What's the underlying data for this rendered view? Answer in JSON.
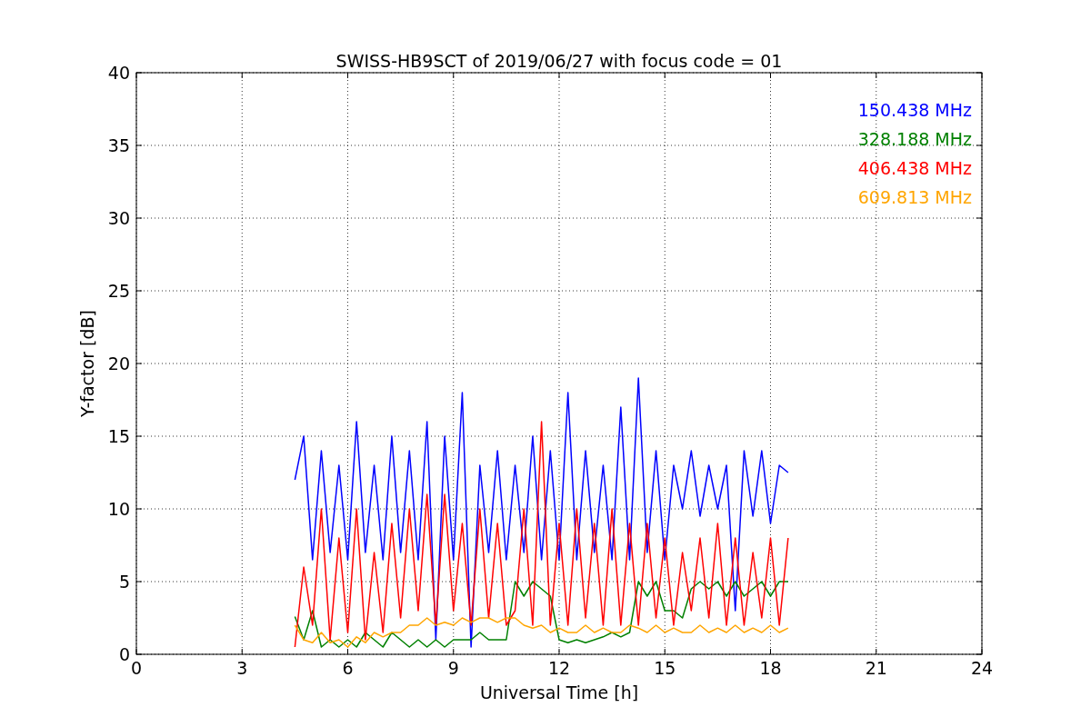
{
  "chart_data": {
    "type": "line",
    "grid": true,
    "title": "SWISS-HB9SCT of 2019/06/27 with focus code = 01",
    "xlabel": "Universal Time [h]",
    "ylabel": "Y-factor [dB]",
    "xlim": [
      0,
      24
    ],
    "ylim": [
      0,
      40
    ],
    "xticks": [
      0,
      3,
      6,
      9,
      12,
      15,
      18,
      21,
      24
    ],
    "yticks": [
      0,
      5,
      10,
      15,
      20,
      25,
      30,
      35,
      40
    ],
    "x": [
      4.5,
      4.75,
      5,
      5.25,
      5.5,
      5.75,
      6,
      6.25,
      6.5,
      6.75,
      7,
      7.25,
      7.5,
      7.75,
      8,
      8.25,
      8.5,
      8.75,
      9,
      9.25,
      9.5,
      9.75,
      10,
      10.25,
      10.5,
      10.75,
      11,
      11.25,
      11.5,
      11.75,
      12,
      12.25,
      12.5,
      12.75,
      13,
      13.25,
      13.5,
      13.75,
      14,
      14.25,
      14.5,
      14.75,
      15,
      15.25,
      15.5,
      15.75,
      16,
      16.25,
      16.5,
      16.75,
      17,
      17.25,
      17.5,
      17.75,
      18,
      18.25,
      18.5
    ],
    "series": [
      {
        "name": "150.438 MHz",
        "color": "#0000ff",
        "values": [
          12,
          15,
          6.5,
          14,
          7,
          13,
          6.5,
          16,
          7,
          13,
          6.5,
          15,
          7,
          14,
          6.5,
          16,
          1,
          15,
          6.5,
          18,
          0.5,
          13,
          7,
          14,
          6.5,
          13,
          7,
          15,
          6.5,
          14,
          6.5,
          18,
          6.5,
          14,
          7,
          13,
          6.5,
          17,
          6.5,
          19,
          7,
          14,
          6.5,
          13,
          10,
          14,
          9.5,
          13,
          10,
          13,
          3,
          14,
          9.5,
          14,
          9,
          13,
          12.5
        ]
      },
      {
        "name": "328.188 MHz",
        "color": "#008000",
        "values": [
          2.6,
          1,
          3,
          0.5,
          1,
          0.5,
          1,
          0.5,
          1.5,
          1,
          0.5,
          1.5,
          1,
          0.5,
          1,
          0.5,
          1,
          0.5,
          1,
          1,
          1,
          1.5,
          1,
          1,
          1,
          5,
          4,
          5,
          4.5,
          4,
          1,
          0.8,
          1,
          0.8,
          1,
          1.2,
          1.5,
          1.2,
          1.5,
          5,
          4,
          5,
          3,
          3,
          2.5,
          4.5,
          5,
          4.5,
          5,
          4,
          5,
          4,
          4.5,
          5,
          4,
          5,
          5
        ]
      },
      {
        "name": "406.438 MHz",
        "color": "#ff0000",
        "values": [
          0.5,
          6,
          2,
          10,
          1,
          8,
          1.5,
          10,
          1,
          7,
          1.5,
          9,
          2.5,
          10,
          3,
          11,
          2,
          11,
          3,
          9,
          2,
          10,
          2.5,
          9,
          2,
          3,
          10,
          2,
          16,
          2,
          9,
          2,
          10,
          2.5,
          9,
          2,
          10,
          2,
          9,
          2,
          9,
          2.5,
          8,
          2,
          7,
          3,
          8,
          2.5,
          9,
          2,
          8,
          2,
          7,
          2.5,
          8,
          2,
          8
        ]
      },
      {
        "name": "609.813 MHz",
        "color": "#ffa500",
        "values": [
          2,
          1,
          0.8,
          1.5,
          0.8,
          1,
          0.5,
          1.2,
          0.8,
          1.5,
          1.2,
          1.5,
          1.5,
          2,
          2,
          2.5,
          2,
          2.2,
          2,
          2.5,
          2.2,
          2.5,
          2.5,
          2.2,
          2.5,
          2.5,
          2,
          1.8,
          2,
          1.5,
          1.8,
          1.5,
          1.5,
          2,
          1.5,
          1.8,
          1.5,
          1.5,
          2,
          1.8,
          1.5,
          2,
          1.5,
          1.8,
          1.5,
          1.5,
          2,
          1.5,
          1.8,
          1.5,
          2,
          1.5,
          1.8,
          1.5,
          2,
          1.5,
          1.8
        ]
      }
    ]
  }
}
